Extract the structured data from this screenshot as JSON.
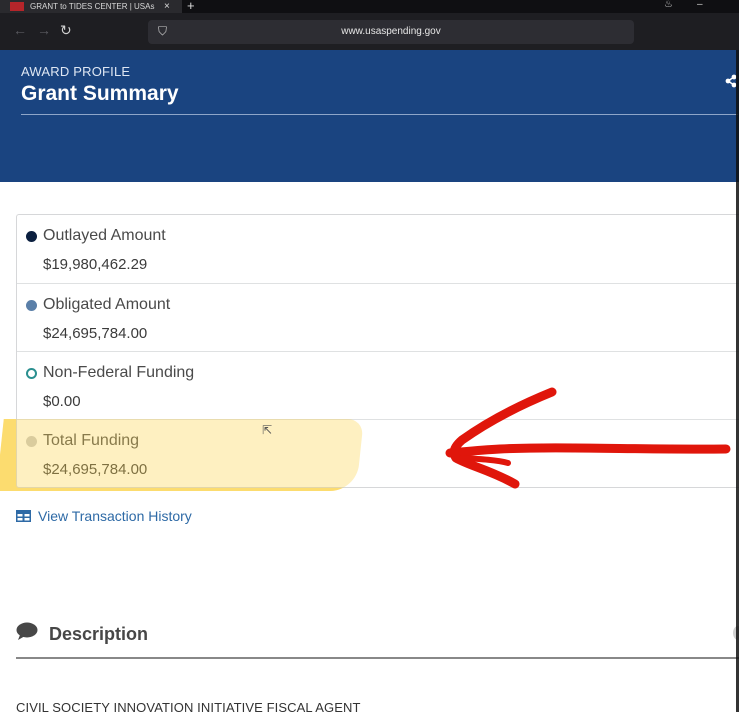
{
  "browser": {
    "tab_title": "GRANT to TIDES CENTER | USAs",
    "tab_close": "×",
    "new_tab": "+",
    "url": "www.usaspending.gov"
  },
  "header": {
    "eyebrow": "AWARD PROFILE",
    "title": "Grant Summary"
  },
  "funding": {
    "rows": [
      {
        "label": "Outlayed Amount",
        "value": "$19,980,462.29",
        "color": "#0b1f3f"
      },
      {
        "label": "Obligated Amount",
        "value": "$24,695,784.00",
        "color": "#5a7fa8"
      },
      {
        "label": "Non-Federal Funding",
        "value": "$0.00",
        "color": "#2a8f8f"
      },
      {
        "label": "Total Funding",
        "value": "$24,695,784.00",
        "color": "#c8c8c8"
      }
    ]
  },
  "links": {
    "view_transaction_history": "View Transaction History"
  },
  "description": {
    "title": "Description",
    "text": "CIVIL SOCIETY INNOVATION INITIATIVE FISCAL AGENT"
  },
  "colors": {
    "header_bg": "#1a4480",
    "link": "#2e6aa6",
    "highlight": "#fbd34d",
    "annotation": "#e0160b"
  },
  "icons": [
    "shield-icon",
    "share-icon",
    "table-icon",
    "speech-bubble-icon",
    "cursor-icon"
  ]
}
